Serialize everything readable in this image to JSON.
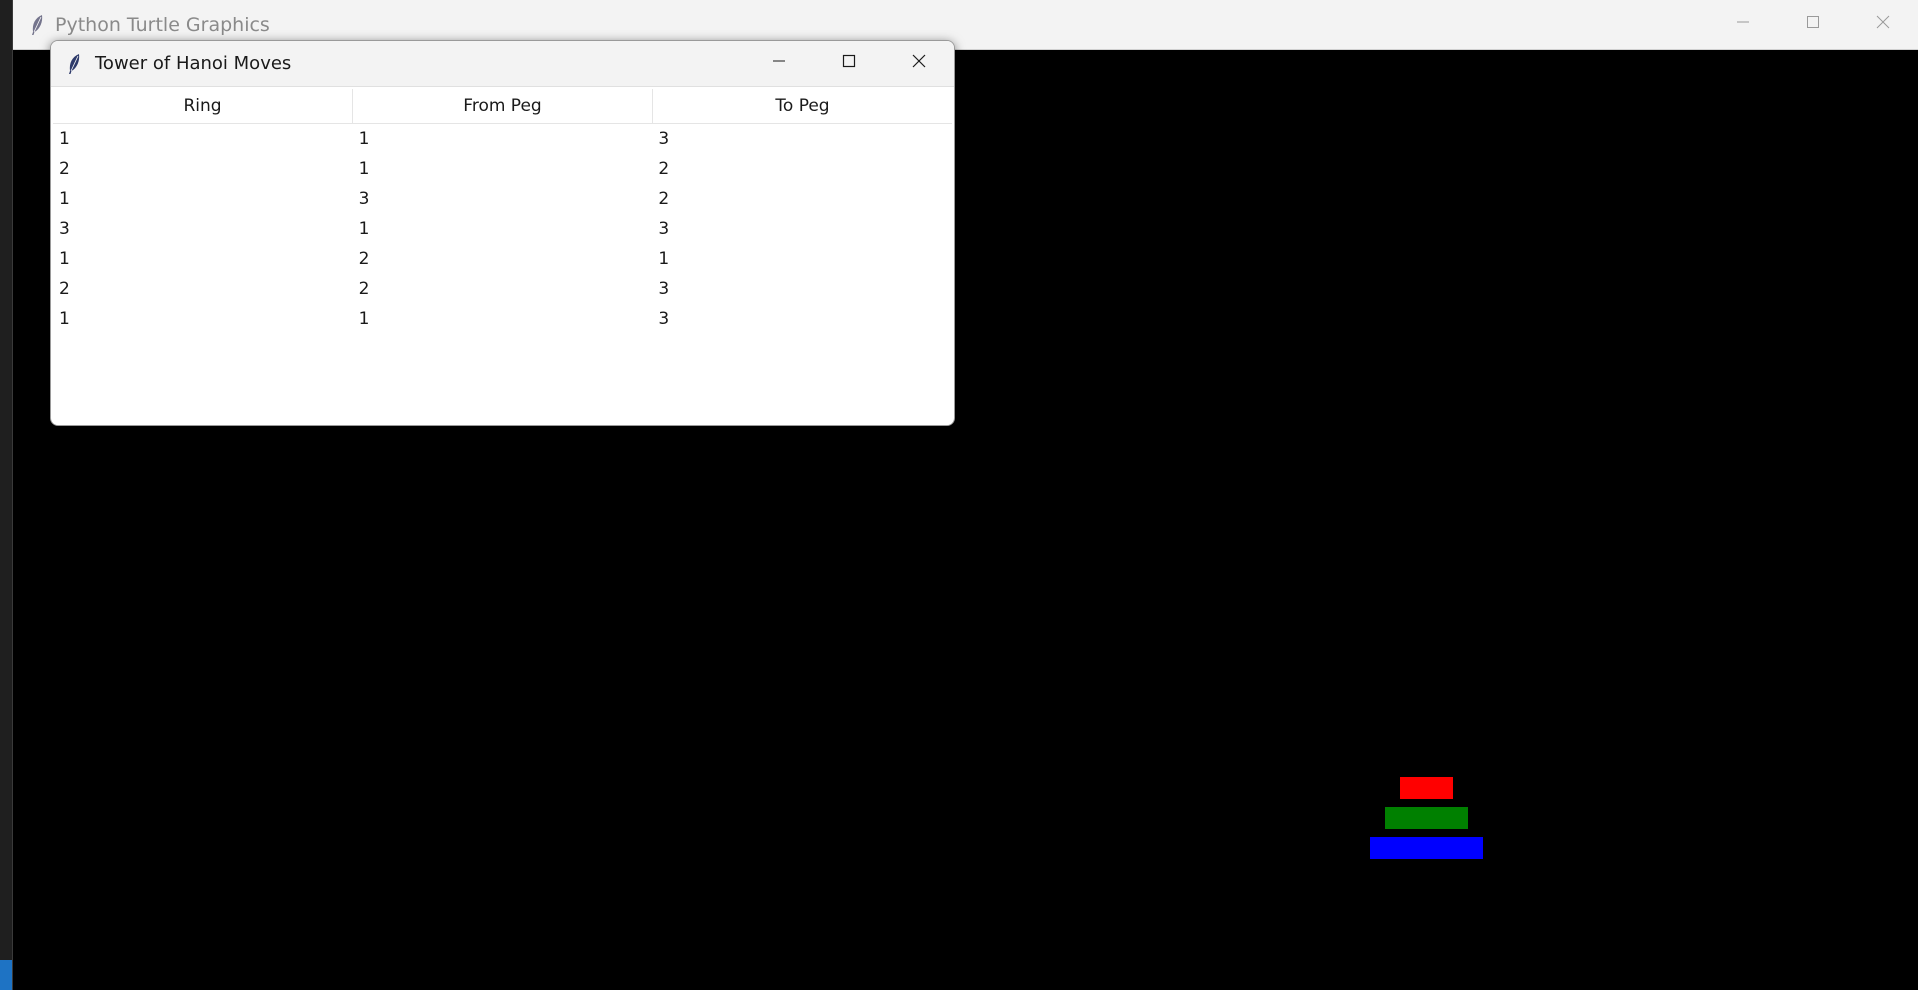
{
  "main_window": {
    "title": "Python Turtle Graphics"
  },
  "canvas": {
    "background": "#000000",
    "rings": [
      {
        "ring": 1,
        "color": "#ff0000"
      },
      {
        "ring": 2,
        "color": "#008000"
      },
      {
        "ring": 3,
        "color": "#0000ff"
      }
    ]
  },
  "dialog": {
    "title": "Tower of Hanoi Moves",
    "columns": [
      "Ring",
      "From Peg",
      "To Peg"
    ],
    "rows": [
      [
        "1",
        "1",
        "3"
      ],
      [
        "2",
        "1",
        "2"
      ],
      [
        "1",
        "3",
        "2"
      ],
      [
        "3",
        "1",
        "3"
      ],
      [
        "1",
        "2",
        "1"
      ],
      [
        "2",
        "2",
        "3"
      ],
      [
        "1",
        "1",
        "3"
      ]
    ]
  },
  "icons": {
    "app": "feather-icon",
    "minimize": "minimize-icon",
    "maximize": "maximize-icon",
    "close": "close-icon"
  }
}
